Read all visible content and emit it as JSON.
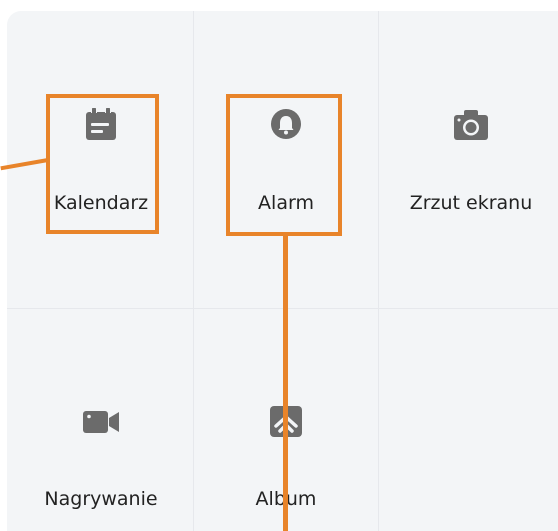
{
  "tiles": [
    {
      "label": "Kalendarz",
      "icon": "calendar-icon"
    },
    {
      "label": "Alarm",
      "icon": "bell-icon"
    },
    {
      "label": "Zrzut ekranu",
      "icon": "camera-icon"
    },
    {
      "label": "Nagrywanie",
      "icon": "video-camera-icon"
    },
    {
      "label": "Album",
      "icon": "photo-icon"
    }
  ],
  "colors": {
    "panel": "#f3f5f7",
    "icon": "#6b6b6b",
    "text": "#222222",
    "highlight": "#e8842a"
  }
}
